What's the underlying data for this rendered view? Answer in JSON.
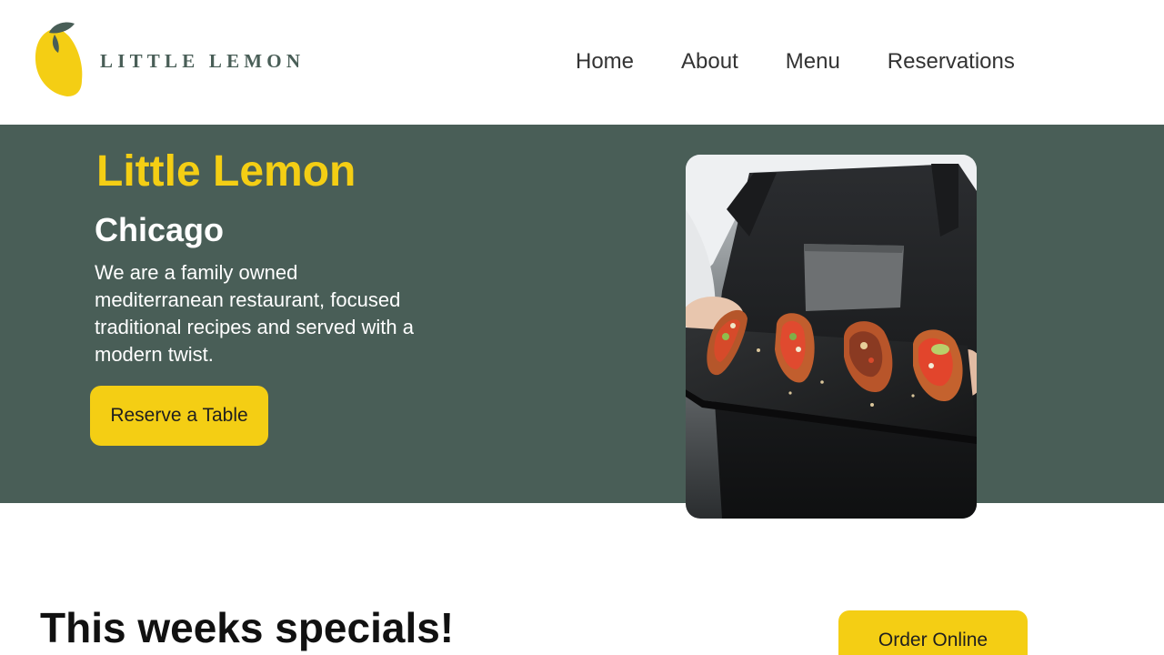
{
  "brand": {
    "logo_text": "LITTLE LEMON",
    "colors": {
      "primary_green": "#495e57",
      "primary_yellow": "#f4ce14"
    }
  },
  "nav": {
    "items": [
      {
        "label": "Home"
      },
      {
        "label": "About"
      },
      {
        "label": "Menu"
      },
      {
        "label": "Reservations"
      }
    ]
  },
  "hero": {
    "title": "Little Lemon",
    "subtitle": "Chicago",
    "description": "We are a family owned mediterranean restaurant, focused traditional recipes and served with a modern twist.",
    "cta_label": "Reserve a Table",
    "image_icon": "food-platter-photo"
  },
  "specials": {
    "title": "This weeks specials!",
    "cta_label": "Order Online"
  }
}
